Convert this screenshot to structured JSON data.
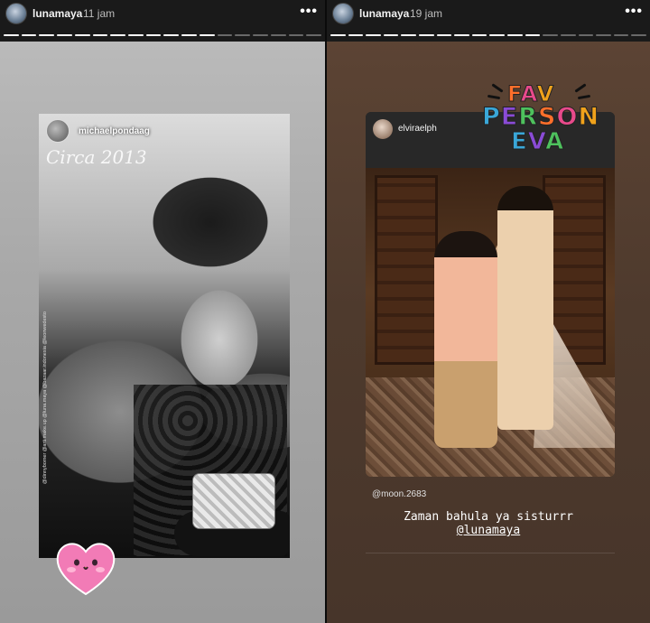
{
  "left_story": {
    "username": "lunamaya",
    "time": "11 jam",
    "more_label": "•••",
    "progress": {
      "total": 18,
      "completed": 12
    },
    "post": {
      "username": "michaelpondaag",
      "caption_script": "Circa 2013",
      "vertical_credit": "@dinnybomer @arti.make.up @luna.maya @bazaar.indonesia @leonwedesto"
    },
    "sticker": "pink-heart-face"
  },
  "right_story": {
    "username": "lunamaya",
    "time": "19 jam",
    "more_label": "•••",
    "progress": {
      "total": 18,
      "completed": 12
    },
    "post": {
      "username": "elviraelph"
    },
    "sticker_words": [
      "FAV",
      "PERSON",
      "EVA"
    ],
    "sticker_colors": [
      "#ff6f2b",
      "#e84a8b",
      "#f0a21b",
      "#3aa7d8",
      "#8a4bd6",
      "#4ec15d"
    ],
    "mention_top": "@moon.2683",
    "caption_line1": "Zaman bahula ya sisturrr",
    "caption_mention": "@lunamaya"
  }
}
